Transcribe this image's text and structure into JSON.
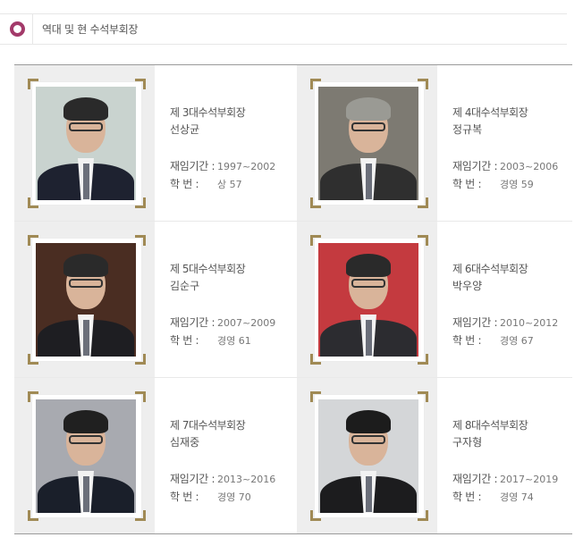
{
  "header": {
    "title": "역대 및 현 수석부회장",
    "icon": "ring-icon",
    "accent": "#a33a6a"
  },
  "members": [
    {
      "role": "제 3대수석부회장",
      "name": "선상균",
      "term_label": "재임기간 :",
      "term": "1997~2002",
      "id_label": "학      번 :",
      "id": "상 57",
      "bg": "#c9d3cf",
      "hair": "#2a2a2a",
      "suit": "#1e2230"
    },
    {
      "role": "제 4대수석부회장",
      "name": "정규복",
      "term_label": "재임기간 :",
      "term": "2003~2006",
      "id_label": "학      번 :",
      "id": "경영 59",
      "bg": "#7d7a72",
      "hair": "#9a9a94",
      "suit": "#2f2f2f"
    },
    {
      "role": "제 5대수석부회장",
      "name": "김순구",
      "term_label": "재임기간 :",
      "term": "2007~2009",
      "id_label": "학      번 :",
      "id": "경영 61",
      "bg": "#4a2d22",
      "hair": "#2a2a2a",
      "suit": "#1e1e22"
    },
    {
      "role": "제 6대수석부회장",
      "name": "박우양",
      "term_label": "재임기간 :",
      "term": "2010~2012",
      "id_label": "학      번 :",
      "id": "경영 67",
      "bg": "#c43a3f",
      "hair": "#2a2a2a",
      "suit": "#2c2c30"
    },
    {
      "role": "제 7대수석부회장",
      "name": "심재중",
      "term_label": "재임기간 :",
      "term": "2013~2016",
      "id_label": "학      번 :",
      "id": "경영 70",
      "bg": "#a8aab0",
      "hair": "#202020",
      "suit": "#1a1f2a"
    },
    {
      "role": "제 8대수석부회장",
      "name": "구자형",
      "term_label": "재임기간 :",
      "term": "2017~2019",
      "id_label": "학      번 :",
      "id": "경영 74",
      "bg": "#d4d6d8",
      "hair": "#1c1c1c",
      "suit": "#1c1c1e"
    }
  ]
}
